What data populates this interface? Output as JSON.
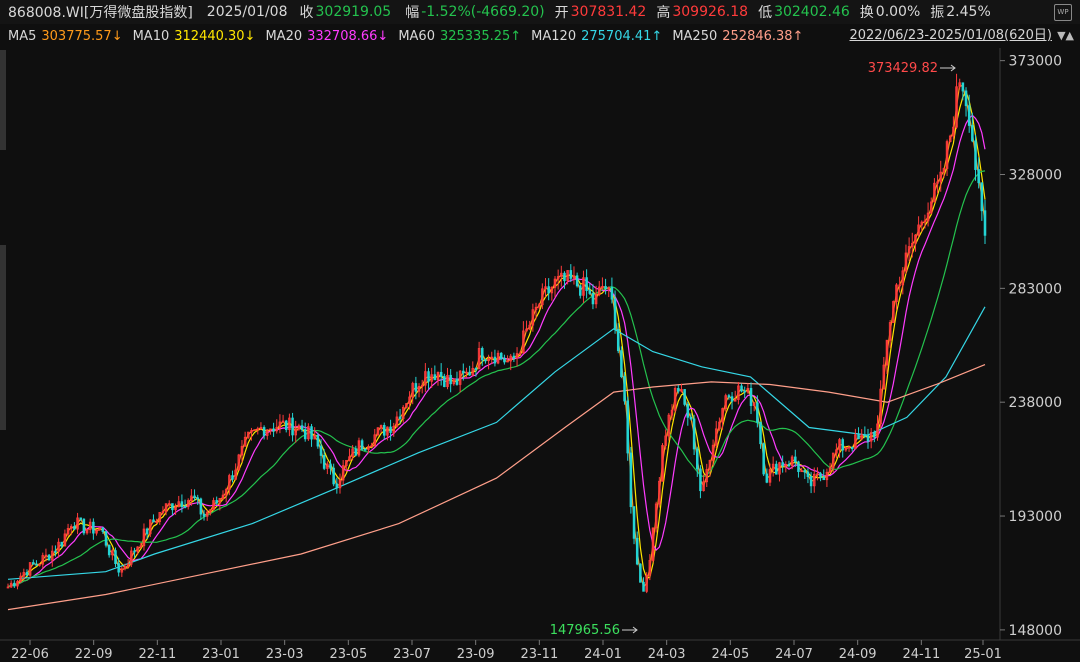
{
  "header": {
    "code": "868008.WI[万得微盘股指数]",
    "date": "2025/01/08",
    "close_label": "收",
    "close": "302919.05",
    "change_label": "幅",
    "change": "-1.52%(-4669.20)",
    "open_label": "开",
    "open": "307831.42",
    "high_label": "高",
    "high": "309926.18",
    "low_label": "低",
    "low": "302402.46",
    "turnover_label": "换",
    "turnover": "0.00%",
    "amplitude_label": "振",
    "amplitude": "2.45%",
    "wp_icon": "wp-icon"
  },
  "ma": [
    {
      "label": "MA5",
      "value": "303775.57↓",
      "color": "#ff9a1a"
    },
    {
      "label": "MA10",
      "value": "312440.30↓",
      "color": "#ffe600"
    },
    {
      "label": "MA20",
      "value": "332708.66↓",
      "color": "#ff3cff"
    },
    {
      "label": "MA60",
      "value": "325335.25↑",
      "color": "#24c24e"
    },
    {
      "label": "MA120",
      "value": "275704.41↑",
      "color": "#35d7e6"
    },
    {
      "label": "MA250",
      "value": "252846.38↑",
      "color": "#ff9f8a"
    }
  ],
  "range_label": "2022/06/23-2025/01/08(620日)",
  "chart_data": {
    "type": "candlestick",
    "y_ticks": [
      148000,
      193000,
      238000,
      283000,
      328000,
      373000
    ],
    "y_tick_labels": [
      "148000",
      "193000",
      "238000",
      "283000",
      "328000",
      "373000"
    ],
    "ylim": [
      144000,
      378000
    ],
    "x_tick_labels": [
      "22-06",
      "22-09",
      "22-11",
      "23-01",
      "23-03",
      "23-05",
      "23-07",
      "23-09",
      "23-11",
      "24-01",
      "24-03",
      "24-05",
      "24-07",
      "24-09",
      "24-11",
      "25-01"
    ],
    "max_annotation": "373429.82",
    "min_annotation": "147965.56",
    "close_series": [
      {
        "x": 0.0,
        "y": 165000
      },
      {
        "x": 0.02,
        "y": 172000
      },
      {
        "x": 0.04,
        "y": 177000
      },
      {
        "x": 0.055,
        "y": 183000
      },
      {
        "x": 0.065,
        "y": 191000
      },
      {
        "x": 0.08,
        "y": 188000
      },
      {
        "x": 0.095,
        "y": 188000
      },
      {
        "x": 0.105,
        "y": 178000
      },
      {
        "x": 0.115,
        "y": 171000
      },
      {
        "x": 0.13,
        "y": 180000
      },
      {
        "x": 0.145,
        "y": 189000
      },
      {
        "x": 0.16,
        "y": 196000
      },
      {
        "x": 0.175,
        "y": 199000
      },
      {
        "x": 0.19,
        "y": 200000
      },
      {
        "x": 0.2,
        "y": 193000
      },
      {
        "x": 0.215,
        "y": 199000
      },
      {
        "x": 0.23,
        "y": 210000
      },
      {
        "x": 0.245,
        "y": 223000
      },
      {
        "x": 0.26,
        "y": 228000
      },
      {
        "x": 0.28,
        "y": 229000
      },
      {
        "x": 0.3,
        "y": 228000
      },
      {
        "x": 0.315,
        "y": 222000
      },
      {
        "x": 0.325,
        "y": 213000
      },
      {
        "x": 0.335,
        "y": 206000
      },
      {
        "x": 0.345,
        "y": 213000
      },
      {
        "x": 0.36,
        "y": 221000
      },
      {
        "x": 0.38,
        "y": 226000
      },
      {
        "x": 0.395,
        "y": 230000
      },
      {
        "x": 0.41,
        "y": 241000
      },
      {
        "x": 0.425,
        "y": 249000
      },
      {
        "x": 0.44,
        "y": 250000
      },
      {
        "x": 0.455,
        "y": 245000
      },
      {
        "x": 0.47,
        "y": 249000
      },
      {
        "x": 0.485,
        "y": 258000
      },
      {
        "x": 0.5,
        "y": 257000
      },
      {
        "x": 0.515,
        "y": 253000
      },
      {
        "x": 0.53,
        "y": 265000
      },
      {
        "x": 0.545,
        "y": 278000
      },
      {
        "x": 0.56,
        "y": 285000
      },
      {
        "x": 0.575,
        "y": 286000
      },
      {
        "x": 0.59,
        "y": 283000
      },
      {
        "x": 0.6,
        "y": 277000
      },
      {
        "x": 0.61,
        "y": 285000
      },
      {
        "x": 0.62,
        "y": 275000
      },
      {
        "x": 0.63,
        "y": 241000
      },
      {
        "x": 0.64,
        "y": 185000
      },
      {
        "x": 0.65,
        "y": 162000
      },
      {
        "x": 0.66,
        "y": 185000
      },
      {
        "x": 0.67,
        "y": 222000
      },
      {
        "x": 0.685,
        "y": 245000
      },
      {
        "x": 0.7,
        "y": 228000
      },
      {
        "x": 0.71,
        "y": 200000
      },
      {
        "x": 0.72,
        "y": 221000
      },
      {
        "x": 0.735,
        "y": 241000
      },
      {
        "x": 0.75,
        "y": 243000
      },
      {
        "x": 0.765,
        "y": 238000
      },
      {
        "x": 0.775,
        "y": 208000
      },
      {
        "x": 0.79,
        "y": 214000
      },
      {
        "x": 0.805,
        "y": 215000
      },
      {
        "x": 0.82,
        "y": 205000
      },
      {
        "x": 0.835,
        "y": 210000
      },
      {
        "x": 0.85,
        "y": 220000
      },
      {
        "x": 0.865,
        "y": 222000
      },
      {
        "x": 0.88,
        "y": 224000
      },
      {
        "x": 0.89,
        "y": 228000
      },
      {
        "x": 0.9,
        "y": 265000
      },
      {
        "x": 0.91,
        "y": 285000
      },
      {
        "x": 0.925,
        "y": 300000
      },
      {
        "x": 0.94,
        "y": 315000
      },
      {
        "x": 0.955,
        "y": 325000
      },
      {
        "x": 0.965,
        "y": 345000
      },
      {
        "x": 0.975,
        "y": 368000
      },
      {
        "x": 0.985,
        "y": 350000
      },
      {
        "x": 0.995,
        "y": 315000
      },
      {
        "x": 1.0,
        "y": 302919
      }
    ],
    "ma_series": [
      {
        "name": "MA5",
        "color": "#ff9a1a"
      },
      {
        "name": "MA10",
        "color": "#ffe600"
      },
      {
        "name": "MA20",
        "color": "#ff3cff"
      },
      {
        "name": "MA60",
        "color": "#24c24e"
      },
      {
        "name": "MA120",
        "color": "#35d7e6",
        "points": [
          {
            "x": 0.0,
            "y": 168000
          },
          {
            "x": 0.1,
            "y": 171000
          },
          {
            "x": 0.15,
            "y": 178000
          },
          {
            "x": 0.25,
            "y": 190000
          },
          {
            "x": 0.33,
            "y": 203000
          },
          {
            "x": 0.42,
            "y": 218000
          },
          {
            "x": 0.5,
            "y": 230000
          },
          {
            "x": 0.56,
            "y": 250000
          },
          {
            "x": 0.62,
            "y": 267000
          },
          {
            "x": 0.66,
            "y": 258000
          },
          {
            "x": 0.71,
            "y": 252000
          },
          {
            "x": 0.76,
            "y": 248000
          },
          {
            "x": 0.82,
            "y": 228000
          },
          {
            "x": 0.88,
            "y": 225000
          },
          {
            "x": 0.92,
            "y": 232000
          },
          {
            "x": 0.96,
            "y": 248000
          },
          {
            "x": 1.0,
            "y": 275704
          }
        ]
      },
      {
        "name": "MA250",
        "color": "#ff9f8a",
        "points": [
          {
            "x": 0.0,
            "y": 156000
          },
          {
            "x": 0.1,
            "y": 162000
          },
          {
            "x": 0.2,
            "y": 170000
          },
          {
            "x": 0.3,
            "y": 178000
          },
          {
            "x": 0.4,
            "y": 190000
          },
          {
            "x": 0.5,
            "y": 208000
          },
          {
            "x": 0.57,
            "y": 228000
          },
          {
            "x": 0.62,
            "y": 242000
          },
          {
            "x": 0.66,
            "y": 244000
          },
          {
            "x": 0.72,
            "y": 246000
          },
          {
            "x": 0.78,
            "y": 245000
          },
          {
            "x": 0.84,
            "y": 242000
          },
          {
            "x": 0.9,
            "y": 238000
          },
          {
            "x": 0.95,
            "y": 245000
          },
          {
            "x": 1.0,
            "y": 252846
          }
        ]
      }
    ]
  }
}
